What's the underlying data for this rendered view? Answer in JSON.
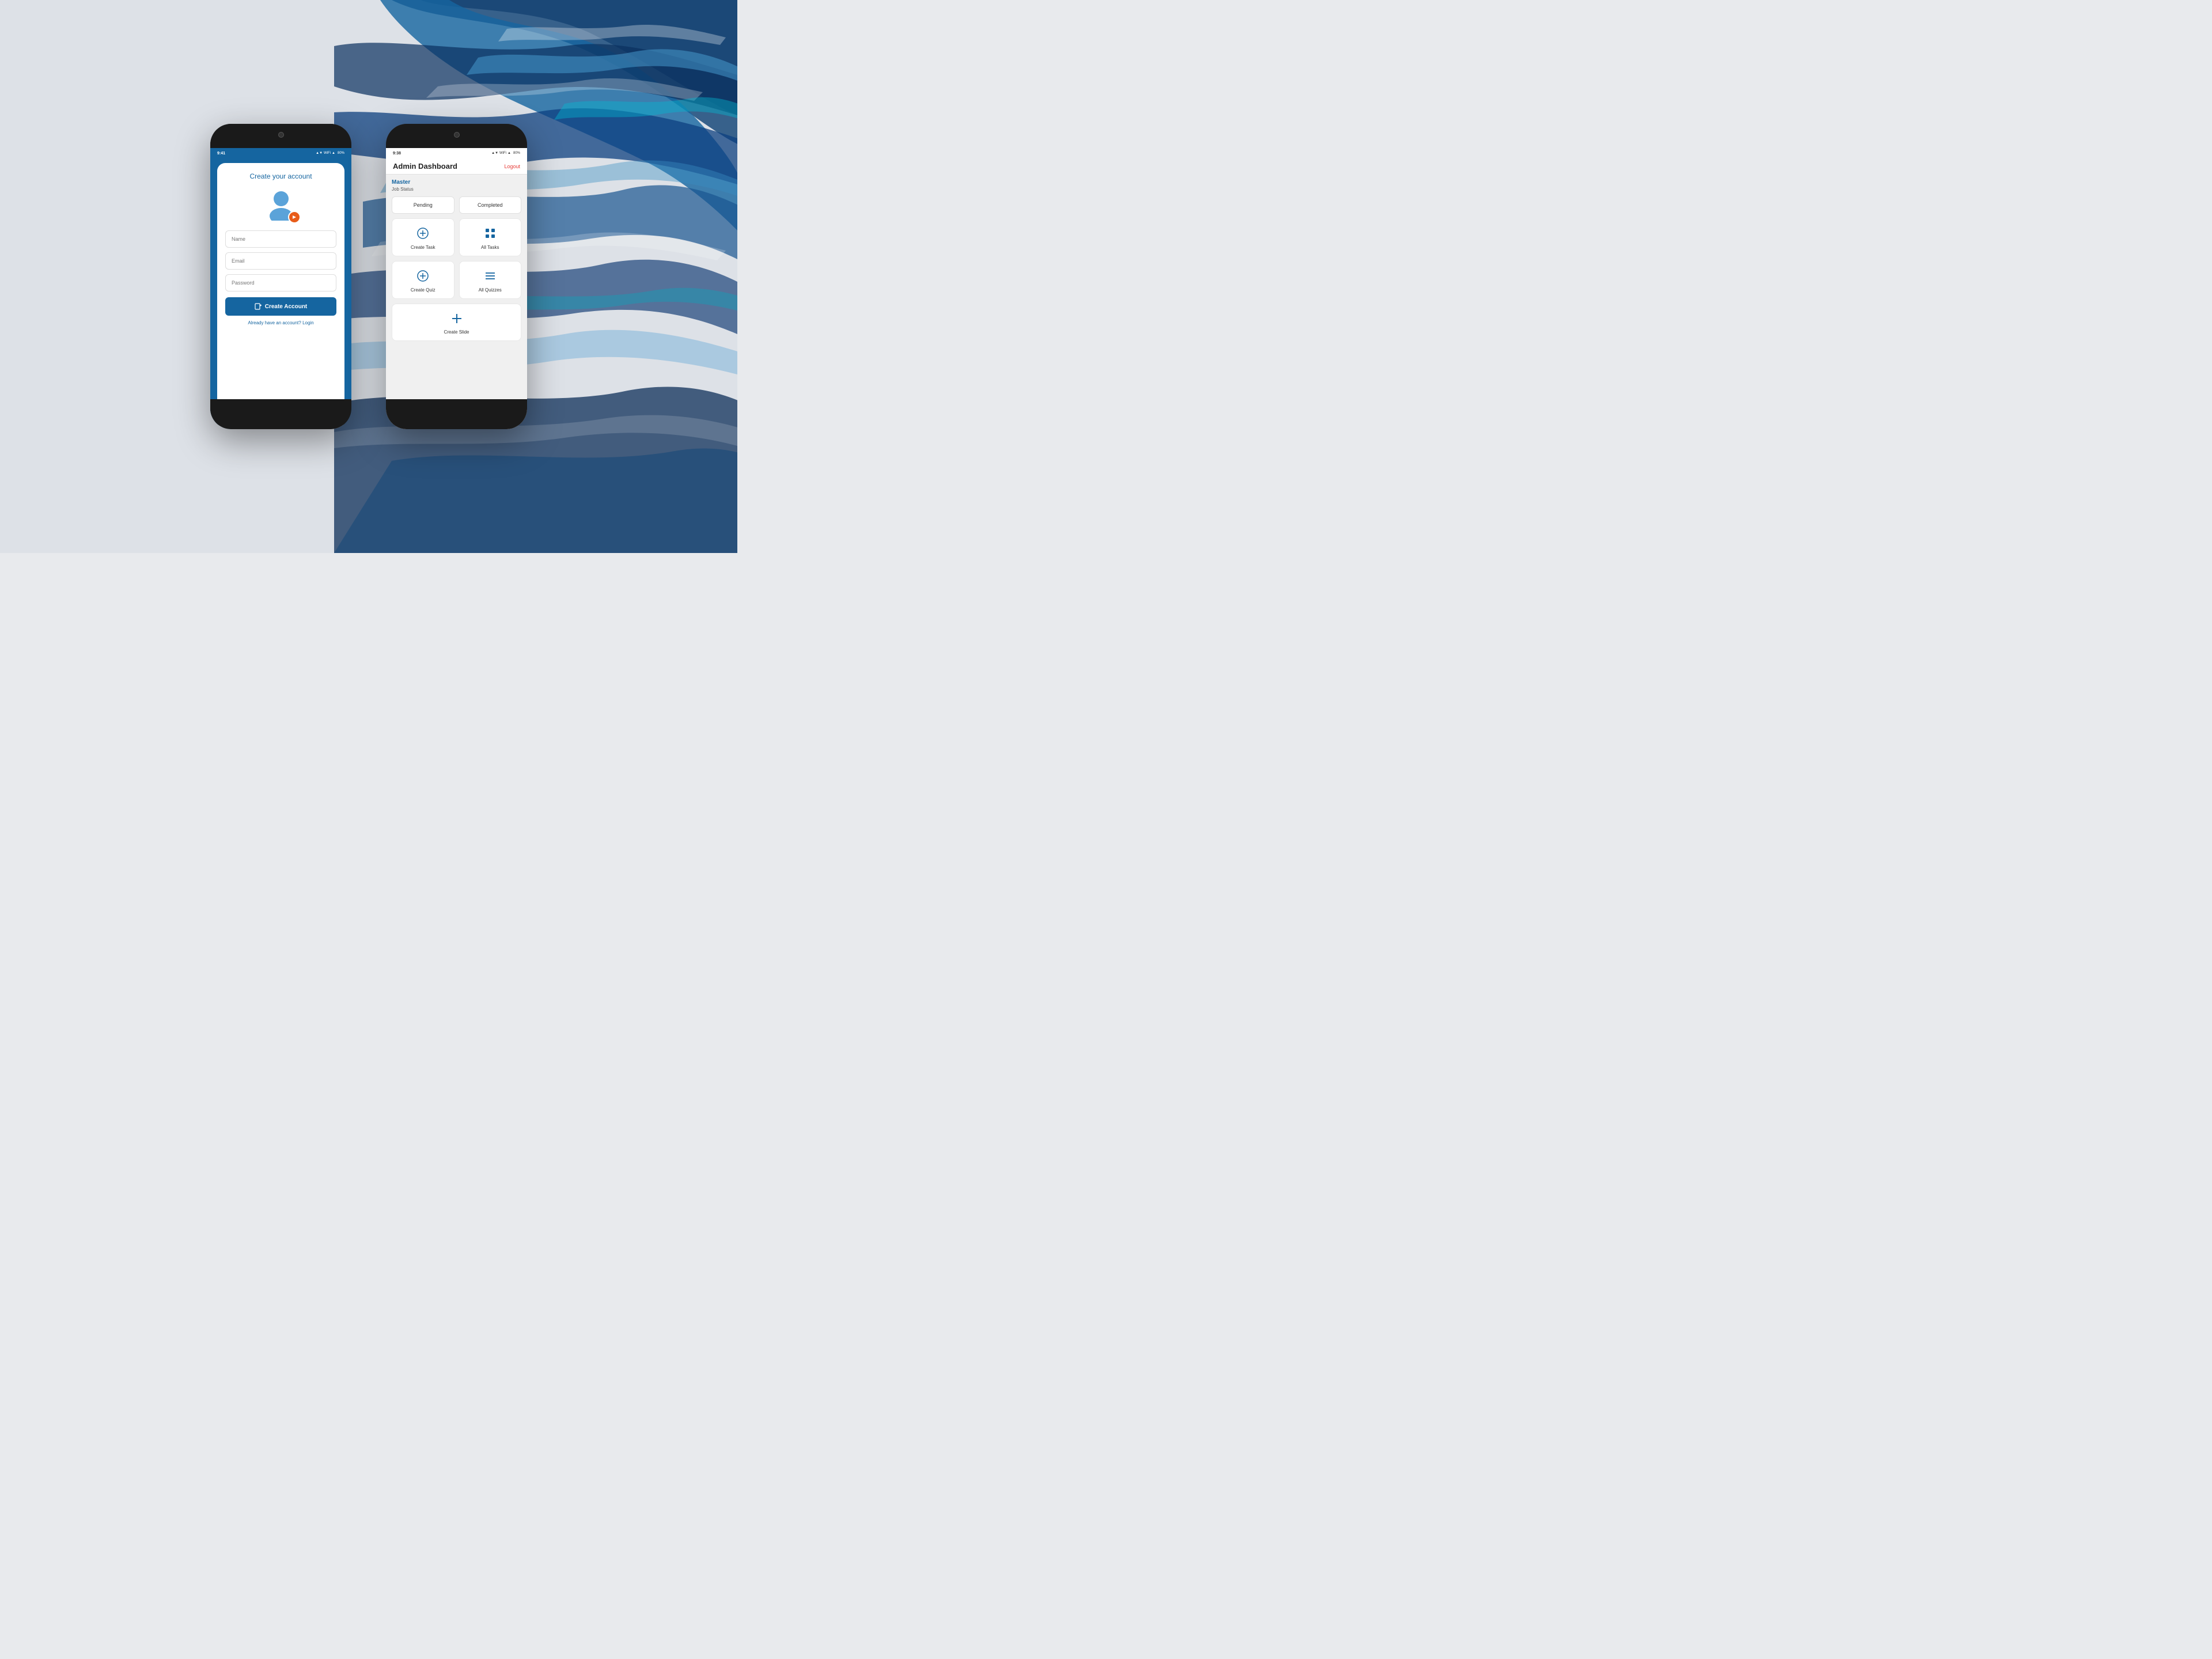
{
  "background": {
    "color": "#dde1e7",
    "splash_color": "#1a4a7a"
  },
  "phone1": {
    "status_time": "9:41",
    "status_battery": "80%",
    "screen": {
      "title": "Create your account",
      "name_placeholder": "Name",
      "email_placeholder": "Email",
      "password_placeholder": "Password",
      "create_button": "Create Account",
      "login_link": "Already have an account? Login"
    }
  },
  "phone2": {
    "status_time": "9:38",
    "status_battery": "80%",
    "screen": {
      "header_title": "Admin Dashboard",
      "logout_label": "Logout",
      "master_label": "Master",
      "job_status_label": "Job Status",
      "status_buttons": [
        "Pending",
        "Completed"
      ],
      "action_cards": [
        {
          "id": "create-task",
          "label": "Create Task",
          "icon": "⊕"
        },
        {
          "id": "all-tasks",
          "label": "All Tasks",
          "icon": "⊞"
        },
        {
          "id": "create-quiz",
          "label": "Create Quiz",
          "icon": "⊕"
        },
        {
          "id": "all-quizzes",
          "label": "All Quizzes",
          "icon": "☰"
        }
      ],
      "create_slide_label": "Create Slide"
    }
  }
}
